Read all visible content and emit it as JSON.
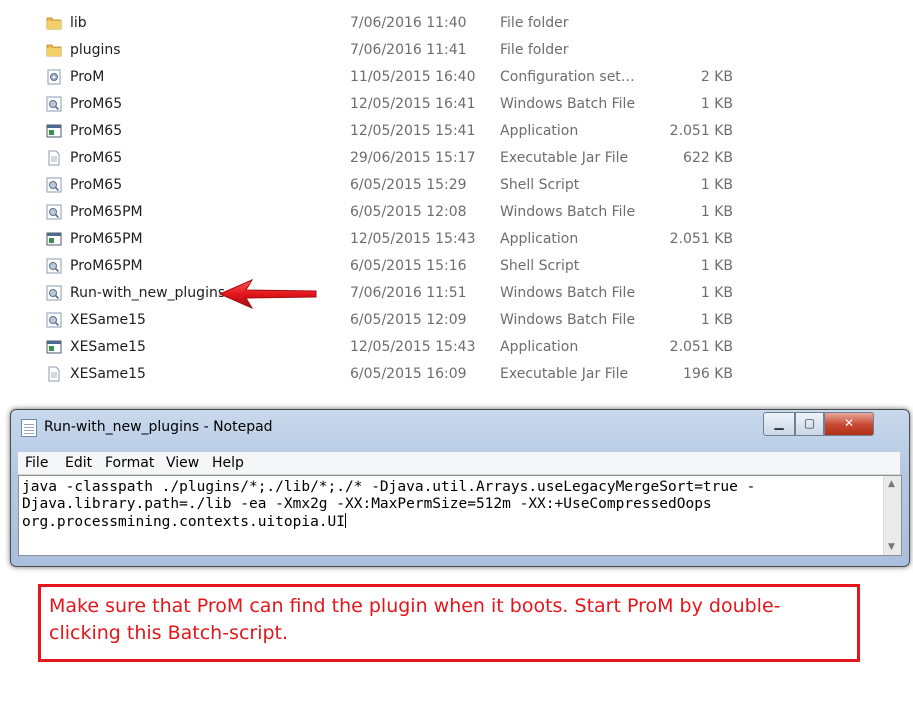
{
  "files": [
    {
      "name": "lib",
      "date": "7/06/2016 11:40",
      "type": "File folder",
      "size": "",
      "icon": "folder-icon"
    },
    {
      "name": "plugins",
      "date": "7/06/2016 11:41",
      "type": "File folder",
      "size": "",
      "icon": "folder-icon"
    },
    {
      "name": "ProM",
      "date": "11/05/2015 16:40",
      "type": "Configuration setti...",
      "size": "2 KB",
      "icon": "config-icon"
    },
    {
      "name": "ProM65",
      "date": "12/05/2015 16:41",
      "type": "Windows Batch File",
      "size": "1 KB",
      "icon": "batch-icon"
    },
    {
      "name": "ProM65",
      "date": "12/05/2015 15:41",
      "type": "Application",
      "size": "2.051 KB",
      "icon": "application-icon"
    },
    {
      "name": "ProM65",
      "date": "29/06/2015 15:17",
      "type": "Executable Jar File",
      "size": "622 KB",
      "icon": "jar-icon"
    },
    {
      "name": "ProM65",
      "date": "6/05/2015 15:29",
      "type": "Shell Script",
      "size": "1 KB",
      "icon": "batch-icon"
    },
    {
      "name": "ProM65PM",
      "date": "6/05/2015 12:08",
      "type": "Windows Batch File",
      "size": "1 KB",
      "icon": "batch-icon"
    },
    {
      "name": "ProM65PM",
      "date": "12/05/2015 15:43",
      "type": "Application",
      "size": "2.051 KB",
      "icon": "application-icon"
    },
    {
      "name": "ProM65PM",
      "date": "6/05/2015 15:16",
      "type": "Shell Script",
      "size": "1 KB",
      "icon": "batch-icon"
    },
    {
      "name": "Run-with_new_plugins",
      "date": "7/06/2016 11:51",
      "type": "Windows Batch File",
      "size": "1 KB",
      "icon": "batch-icon"
    },
    {
      "name": "XESame15",
      "date": "6/05/2015 12:09",
      "type": "Windows Batch File",
      "size": "1 KB",
      "icon": "batch-icon"
    },
    {
      "name": "XESame15",
      "date": "12/05/2015 15:43",
      "type": "Application",
      "size": "2.051 KB",
      "icon": "application-icon"
    },
    {
      "name": "XESame15",
      "date": "6/05/2015 16:09",
      "type": "Executable Jar File",
      "size": "196 KB",
      "icon": "jar-icon"
    }
  ],
  "notepad": {
    "title": "Run-with_new_plugins - Notepad",
    "menu": [
      "File",
      "Edit",
      "Format",
      "View",
      "Help"
    ],
    "content_lines": [
      "java -classpath ./plugins/*;./lib/*;./* -Djava.util.Arrays.useLegacyMergeSort=true -",
      "Djava.library.path=./lib -ea -Xmx2g -XX:MaxPermSize=512m -XX:+UseCompressedOops",
      "org.processmining.contexts.uitopia.UI"
    ]
  },
  "note": {
    "text": "Make sure that ProM can find the plugin when it boots. Start ProM by double-clicking this Batch-script."
  },
  "colors": {
    "annotation_red": "#e4161b",
    "folder_yellow": "#e8b84a"
  }
}
